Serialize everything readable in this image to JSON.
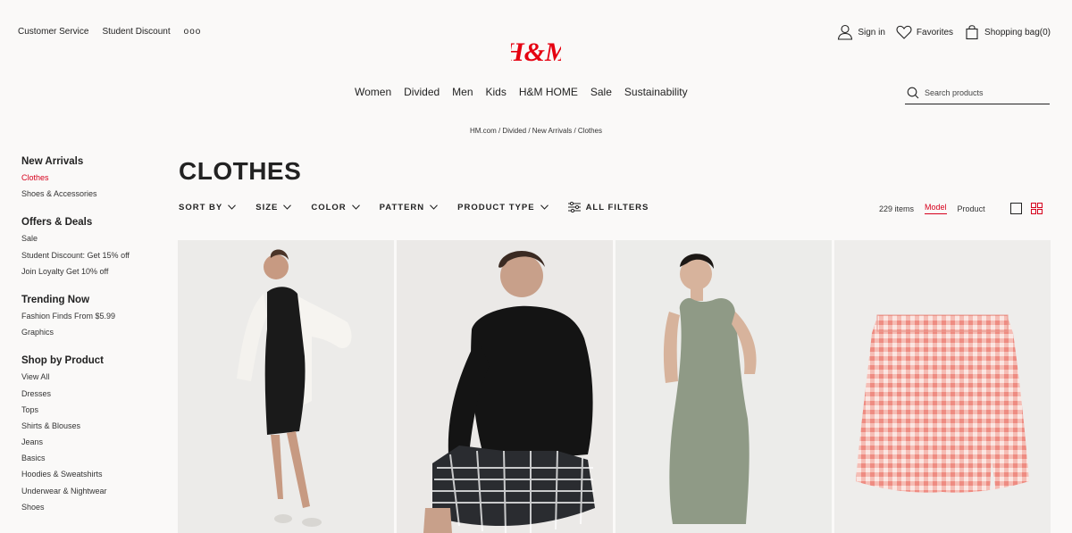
{
  "utility": {
    "customer_service": "Customer Service",
    "student_discount": "Student Discount",
    "more": "ooo"
  },
  "logo_text": "H&M",
  "account": {
    "sign_in": "Sign in",
    "favorites": "Favorites",
    "bag": "Shopping bag(0)"
  },
  "nav": [
    "Women",
    "Divided",
    "Men",
    "Kids",
    "H&M HOME",
    "Sale",
    "Sustainability"
  ],
  "search": {
    "placeholder": "Search products"
  },
  "breadcrumb": "HM.com / Divided / New Arrivals / Clothes",
  "sidebar": {
    "groups": [
      {
        "title": "New Arrivals",
        "items": [
          "Clothes",
          "Shoes & Accessories"
        ],
        "active": "Clothes"
      },
      {
        "title": "Offers & Deals",
        "items": [
          "Sale",
          "Student Discount: Get 15% off",
          "Join Loyalty Get 10% off"
        ]
      },
      {
        "title": "Trending Now",
        "items": [
          "Fashion Finds From $5.99",
          "Graphics"
        ]
      },
      {
        "title": "Shop by Product",
        "items": [
          "View All",
          "Dresses",
          "Tops",
          "Shirts & Blouses",
          "Jeans",
          "Basics",
          "Hoodies & Sweatshirts",
          "Underwear & Nightwear",
          "Shoes"
        ]
      }
    ]
  },
  "page_title": "CLOTHES",
  "filters": [
    "SORT BY",
    "SIZE",
    "COLOR",
    "PATTERN",
    "PRODUCT TYPE"
  ],
  "all_filters": "ALL FILTERS",
  "view": {
    "count": "229 items",
    "model": "Model",
    "product": "Product"
  },
  "colors": {
    "brand": "#e50010",
    "active": "#d6001c"
  },
  "products": [
    {
      "image": "model in black dress with white cardigan"
    },
    {
      "image": "model in black hoodie and checked skirt"
    },
    {
      "image": "model in sage green tank dress"
    },
    {
      "image": "pink gingham mini skirt"
    }
  ]
}
